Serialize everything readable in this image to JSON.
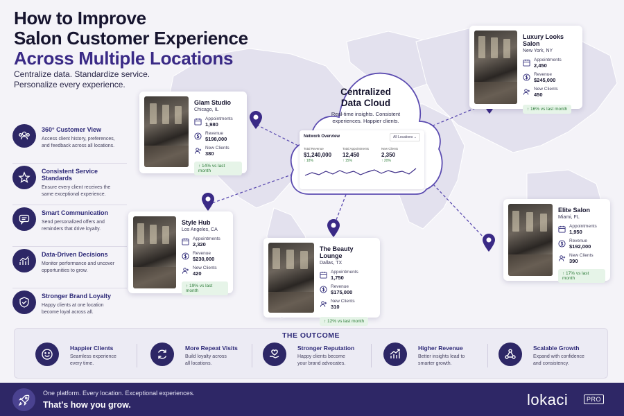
{
  "header": {
    "title_line1": "How to Improve",
    "title_line2": "Salon Customer Experience",
    "title_line3": "Across Multiple Locations",
    "subtitle_line1": "Centralize data. Standardize service.",
    "subtitle_line2": "Personalize every experience."
  },
  "features": [
    {
      "title": "360° Customer View",
      "desc1": "Access client history, preferences,",
      "desc2": "and feedback across all locations.",
      "icon": "users-icon"
    },
    {
      "title": "Consistent Service Standards",
      "desc1": "Ensure every client receives the",
      "desc2": "same exceptional experience.",
      "icon": "star-icon"
    },
    {
      "title": "Smart Communication",
      "desc1": "Send personalized offers and",
      "desc2": "reminders that drive loyalty.",
      "icon": "chat-icon"
    },
    {
      "title": "Data-Driven Decisions",
      "desc1": "Monitor performance and uncover",
      "desc2": "opportunities to grow.",
      "icon": "chart-icon"
    },
    {
      "title": "Stronger Brand Loyalty",
      "desc1": "Happy clients at one location",
      "desc2": "become loyal across all.",
      "icon": "shield-icon"
    }
  ],
  "stat_labels": {
    "appointments": "Appointments",
    "revenue": "Revenue",
    "new_clients": "New Clients"
  },
  "locations": [
    {
      "name": "Glam Studio",
      "city": "Chicago, IL",
      "appointments": "1,980",
      "revenue": "$198,000",
      "new_clients": "380",
      "growth": "↑ 14% vs last month"
    },
    {
      "name": "Luxury Looks Salon",
      "city": "New York, NY",
      "appointments": "2,450",
      "revenue": "$245,000",
      "new_clients": "450",
      "growth": "↑ 16% vs last month"
    },
    {
      "name": "Style Hub",
      "city": "Los Angeles, CA",
      "appointments": "2,320",
      "revenue": "$230,000",
      "new_clients": "420",
      "growth": "↑ 19% vs last month"
    },
    {
      "name": "The Beauty Lounge",
      "city": "Dallas, TX",
      "appointments": "1,750",
      "revenue": "$175,000",
      "new_clients": "310",
      "growth": "↑ 12% vs last month"
    },
    {
      "name": "Elite Salon",
      "city": "Miami, FL",
      "appointments": "1,950",
      "revenue": "$192,000",
      "new_clients": "390",
      "growth": "↑ 17% vs last month"
    }
  ],
  "cloud": {
    "title_line1": "Centralized",
    "title_line2": "Data Cloud",
    "sub_line1": "Real-time insights. Consistent",
    "sub_line2": "experiences. Happier clients.",
    "panel_title": "Network Overview",
    "panel_select": "All Locations",
    "metrics": [
      {
        "label": "Total Revenue",
        "value": "$1,240,000",
        "change": "↑ 18%"
      },
      {
        "label": "Total Appointments",
        "value": "12,450",
        "change": "↑ 15%"
      },
      {
        "label": "New Clients",
        "value": "2,350",
        "change": "↑ 20%"
      }
    ]
  },
  "outcome": {
    "title": "THE OUTCOME",
    "items": [
      {
        "title": "Happier Clients",
        "desc1": "Seamless experience",
        "desc2": "every time.",
        "icon": "smile-icon"
      },
      {
        "title": "More Repeat Visits",
        "desc1": "Build loyalty across",
        "desc2": "all locations.",
        "icon": "refresh-icon"
      },
      {
        "title": "Stronger Reputation",
        "desc1": "Happy clients become",
        "desc2": "your brand advocates.",
        "icon": "heart-hand-icon"
      },
      {
        "title": "Higher Revenue",
        "desc1": "Better insights lead to",
        "desc2": "smarter growth.",
        "icon": "growth-chart-icon"
      },
      {
        "title": "Scalable Growth",
        "desc1": "Expand with confidence",
        "desc2": "and consistency.",
        "icon": "network-icon"
      }
    ]
  },
  "footer": {
    "line1": "One platform. Every location. Exceptional experiences.",
    "line2": "That's how you grow.",
    "logo": "lokaci",
    "badge": "PRO"
  },
  "colors": {
    "primary": "#2d2766",
    "accent": "#3a2a86",
    "growth": "#2f7d3b"
  }
}
